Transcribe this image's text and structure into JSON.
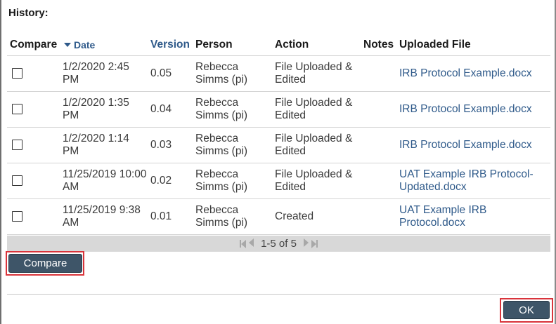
{
  "history": {
    "title": "History:"
  },
  "table": {
    "headers": {
      "compare": "Compare",
      "date": "Date",
      "version": "Version",
      "person": "Person",
      "action": "Action",
      "notes": "Notes",
      "file": "Uploaded File"
    },
    "rows": [
      {
        "checked": false,
        "date": "1/2/2020 2:45 PM",
        "version": "0.05",
        "person": "Rebecca Simms (pi)",
        "action": "File Uploaded & Edited",
        "notes": "",
        "file": "IRB Protocol Example.docx"
      },
      {
        "checked": false,
        "date": "1/2/2020 1:35 PM",
        "version": "0.04",
        "person": "Rebecca Simms (pi)",
        "action": "File Uploaded & Edited",
        "notes": "",
        "file": "IRB Protocol Example.docx"
      },
      {
        "checked": false,
        "date": "1/2/2020 1:14 PM",
        "version": "0.03",
        "person": "Rebecca Simms (pi)",
        "action": "File Uploaded & Edited",
        "notes": "",
        "file": "IRB Protocol Example.docx"
      },
      {
        "checked": false,
        "date": "11/25/2019 10:00 AM",
        "version": "0.02",
        "person": "Rebecca Simms (pi)",
        "action": "File Uploaded & Edited",
        "notes": "",
        "file": "UAT Example IRB Protocol-Updated.docx"
      },
      {
        "checked": false,
        "date": "11/25/2019 9:38 AM",
        "version": "0.01",
        "person": "Rebecca Simms (pi)",
        "action": "Created",
        "notes": "",
        "file": "UAT Example IRB Protocol.docx"
      }
    ]
  },
  "pager": {
    "range": "1-5 of 5",
    "icons": [
      "first-page-icon",
      "prev-page-icon",
      "next-page-icon",
      "last-page-icon"
    ]
  },
  "buttons": {
    "compare": "Compare",
    "ok": "OK"
  },
  "colors": {
    "link": "#2f5a8a",
    "button_bg": "#3e5568",
    "highlight": "#d9343b",
    "pager_bg": "#d8d8d8"
  }
}
